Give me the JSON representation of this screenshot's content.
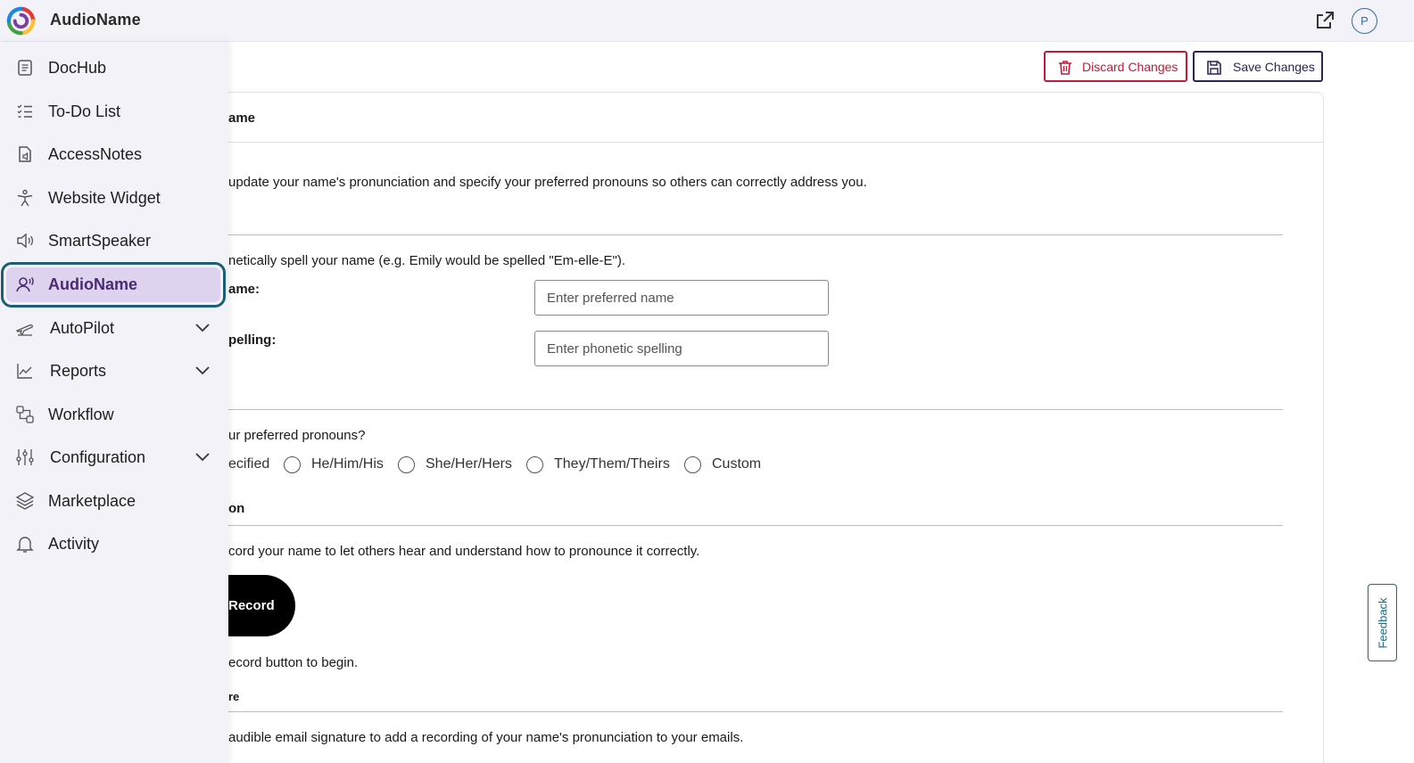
{
  "app": {
    "title": "AudioName",
    "avatar_initial": "P"
  },
  "sidebar": {
    "items": [
      {
        "label": "DocHub"
      },
      {
        "label": "To-Do List"
      },
      {
        "label": "AccessNotes"
      },
      {
        "label": "Website Widget"
      },
      {
        "label": "SmartSpeaker"
      },
      {
        "label": "AudioName",
        "active": true
      },
      {
        "label": "AutoPilot",
        "expandable": true
      },
      {
        "label": "Reports",
        "expandable": true
      },
      {
        "label": "Workflow"
      },
      {
        "label": "Configuration",
        "expandable": true
      },
      {
        "label": "Marketplace"
      },
      {
        "label": "Activity"
      }
    ]
  },
  "actions": {
    "discard_label": "Discard Changes",
    "save_label": "Save Changes"
  },
  "card": {
    "title": "ame",
    "intro": "update your name's pronunciation and specify your preferred pronouns so others can correctly address you.",
    "phonetic_hint": "netically spell your name (e.g. Emily would be spelled \"Em-elle-E\").",
    "preferred_name_label": "ame:",
    "preferred_name_placeholder": "Enter preferred name",
    "phonetic_label": "pelling:",
    "phonetic_placeholder": "Enter phonetic spelling",
    "pronouns_question": "ur preferred pronouns?",
    "pronoun_options": [
      "ecified",
      "He/Him/His",
      "She/Her/Hers",
      "They/Them/Theirs",
      "Custom"
    ],
    "recording_heading": "on",
    "recording_hint": "cord your name to let others hear and understand how to pronounce it correctly.",
    "record_button": "Record",
    "record_prompt": "ecord button to begin.",
    "signature_heading": "re",
    "signature_hint": "audible email signature to add a recording of your name's pronunciation to your emails."
  },
  "feedback_label": "Feedback",
  "colors": {
    "accent": "#4a2a73",
    "active_outline": "#1b5f73",
    "discard": "#c01b3a",
    "save": "#2e2257"
  }
}
